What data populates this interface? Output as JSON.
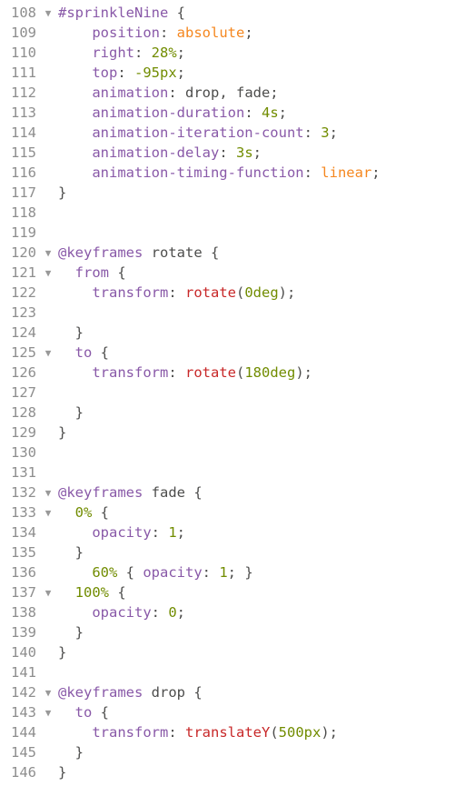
{
  "editor": {
    "lines": [
      {
        "n": "108",
        "fold": "▼",
        "tokens": [
          {
            "t": "#sprinkleNine",
            "c": "sel"
          },
          {
            "t": " {",
            "c": "txt"
          }
        ]
      },
      {
        "n": "109",
        "fold": "",
        "tokens": [
          {
            "t": "    ",
            "c": "txt"
          },
          {
            "t": "position",
            "c": "sel"
          },
          {
            "t": ": ",
            "c": "txt"
          },
          {
            "t": "absolute",
            "c": "val"
          },
          {
            "t": ";",
            "c": "txt"
          }
        ]
      },
      {
        "n": "110",
        "fold": "",
        "tokens": [
          {
            "t": "    ",
            "c": "txt"
          },
          {
            "t": "right",
            "c": "sel"
          },
          {
            "t": ": ",
            "c": "txt"
          },
          {
            "t": "28%",
            "c": "num"
          },
          {
            "t": ";",
            "c": "txt"
          }
        ]
      },
      {
        "n": "111",
        "fold": "",
        "tokens": [
          {
            "t": "    ",
            "c": "txt"
          },
          {
            "t": "top",
            "c": "sel"
          },
          {
            "t": ": ",
            "c": "txt"
          },
          {
            "t": "-95px",
            "c": "num"
          },
          {
            "t": ";",
            "c": "txt"
          }
        ]
      },
      {
        "n": "112",
        "fold": "",
        "tokens": [
          {
            "t": "    ",
            "c": "txt"
          },
          {
            "t": "animation",
            "c": "sel"
          },
          {
            "t": ": drop, fade;",
            "c": "txt"
          }
        ]
      },
      {
        "n": "113",
        "fold": "",
        "tokens": [
          {
            "t": "    ",
            "c": "txt"
          },
          {
            "t": "animation-duration",
            "c": "sel"
          },
          {
            "t": ": ",
            "c": "txt"
          },
          {
            "t": "4s",
            "c": "num"
          },
          {
            "t": ";",
            "c": "txt"
          }
        ]
      },
      {
        "n": "114",
        "fold": "",
        "tokens": [
          {
            "t": "    ",
            "c": "txt"
          },
          {
            "t": "animation-iteration-count",
            "c": "sel"
          },
          {
            "t": ": ",
            "c": "txt"
          },
          {
            "t": "3",
            "c": "num"
          },
          {
            "t": ";",
            "c": "txt"
          }
        ]
      },
      {
        "n": "115",
        "fold": "",
        "tokens": [
          {
            "t": "    ",
            "c": "txt"
          },
          {
            "t": "animation-delay",
            "c": "sel"
          },
          {
            "t": ": ",
            "c": "txt"
          },
          {
            "t": "3s",
            "c": "num"
          },
          {
            "t": ";",
            "c": "txt"
          }
        ]
      },
      {
        "n": "116",
        "fold": "",
        "tokens": [
          {
            "t": "    ",
            "c": "txt"
          },
          {
            "t": "animation-timing-function",
            "c": "sel"
          },
          {
            "t": ": ",
            "c": "txt"
          },
          {
            "t": "linear",
            "c": "val"
          },
          {
            "t": ";",
            "c": "txt"
          }
        ]
      },
      {
        "n": "117",
        "fold": "",
        "tokens": [
          {
            "t": "}",
            "c": "txt"
          }
        ]
      },
      {
        "n": "118",
        "fold": "",
        "tokens": []
      },
      {
        "n": "119",
        "fold": "",
        "tokens": []
      },
      {
        "n": "120",
        "fold": "▼",
        "tokens": [
          {
            "t": "@keyframes",
            "c": "sel"
          },
          {
            "t": " rotate {",
            "c": "txt"
          }
        ]
      },
      {
        "n": "121",
        "fold": "▼",
        "tokens": [
          {
            "t": "  ",
            "c": "txt"
          },
          {
            "t": "from",
            "c": "sel"
          },
          {
            "t": " {",
            "c": "txt"
          }
        ]
      },
      {
        "n": "122",
        "fold": "",
        "tokens": [
          {
            "t": "    ",
            "c": "txt"
          },
          {
            "t": "transform",
            "c": "sel"
          },
          {
            "t": ": ",
            "c": "txt"
          },
          {
            "t": "rotate",
            "c": "fn"
          },
          {
            "t": "(",
            "c": "txt"
          },
          {
            "t": "0deg",
            "c": "num"
          },
          {
            "t": ");",
            "c": "txt"
          }
        ]
      },
      {
        "n": "123",
        "fold": "",
        "tokens": []
      },
      {
        "n": "124",
        "fold": "",
        "tokens": [
          {
            "t": "  }",
            "c": "txt"
          }
        ]
      },
      {
        "n": "125",
        "fold": "▼",
        "tokens": [
          {
            "t": "  ",
            "c": "txt"
          },
          {
            "t": "to",
            "c": "sel"
          },
          {
            "t": " {",
            "c": "txt"
          }
        ]
      },
      {
        "n": "126",
        "fold": "",
        "tokens": [
          {
            "t": "    ",
            "c": "txt"
          },
          {
            "t": "transform",
            "c": "sel"
          },
          {
            "t": ": ",
            "c": "txt"
          },
          {
            "t": "rotate",
            "c": "fn"
          },
          {
            "t": "(",
            "c": "txt"
          },
          {
            "t": "180deg",
            "c": "num"
          },
          {
            "t": ");",
            "c": "txt"
          }
        ]
      },
      {
        "n": "127",
        "fold": "",
        "tokens": []
      },
      {
        "n": "128",
        "fold": "",
        "tokens": [
          {
            "t": "  }",
            "c": "txt"
          }
        ]
      },
      {
        "n": "129",
        "fold": "",
        "tokens": [
          {
            "t": "}",
            "c": "txt"
          }
        ]
      },
      {
        "n": "130",
        "fold": "",
        "tokens": []
      },
      {
        "n": "131",
        "fold": "",
        "tokens": []
      },
      {
        "n": "132",
        "fold": "▼",
        "tokens": [
          {
            "t": "@keyframes",
            "c": "sel"
          },
          {
            "t": " fade {",
            "c": "txt"
          }
        ]
      },
      {
        "n": "133",
        "fold": "▼",
        "tokens": [
          {
            "t": "  ",
            "c": "txt"
          },
          {
            "t": "0%",
            "c": "num"
          },
          {
            "t": " {",
            "c": "txt"
          }
        ]
      },
      {
        "n": "134",
        "fold": "",
        "tokens": [
          {
            "t": "    ",
            "c": "txt"
          },
          {
            "t": "opacity",
            "c": "sel"
          },
          {
            "t": ": ",
            "c": "txt"
          },
          {
            "t": "1",
            "c": "num"
          },
          {
            "t": ";",
            "c": "txt"
          }
        ]
      },
      {
        "n": "135",
        "fold": "",
        "tokens": [
          {
            "t": "  }",
            "c": "txt"
          }
        ]
      },
      {
        "n": "136",
        "fold": "",
        "tokens": [
          {
            "t": "    ",
            "c": "txt"
          },
          {
            "t": "60%",
            "c": "num"
          },
          {
            "t": " { ",
            "c": "txt"
          },
          {
            "t": "opacity",
            "c": "sel"
          },
          {
            "t": ": ",
            "c": "txt"
          },
          {
            "t": "1",
            "c": "num"
          },
          {
            "t": "; }",
            "c": "txt"
          }
        ]
      },
      {
        "n": "137",
        "fold": "▼",
        "tokens": [
          {
            "t": "  ",
            "c": "txt"
          },
          {
            "t": "100%",
            "c": "num"
          },
          {
            "t": " {",
            "c": "txt"
          }
        ]
      },
      {
        "n": "138",
        "fold": "",
        "tokens": [
          {
            "t": "    ",
            "c": "txt"
          },
          {
            "t": "opacity",
            "c": "sel"
          },
          {
            "t": ": ",
            "c": "txt"
          },
          {
            "t": "0",
            "c": "num"
          },
          {
            "t": ";",
            "c": "txt"
          }
        ]
      },
      {
        "n": "139",
        "fold": "",
        "tokens": [
          {
            "t": "  }",
            "c": "txt"
          }
        ]
      },
      {
        "n": "140",
        "fold": "",
        "tokens": [
          {
            "t": "}",
            "c": "txt"
          }
        ]
      },
      {
        "n": "141",
        "fold": "",
        "tokens": []
      },
      {
        "n": "142",
        "fold": "▼",
        "tokens": [
          {
            "t": "@keyframes",
            "c": "sel"
          },
          {
            "t": " drop {",
            "c": "txt"
          }
        ]
      },
      {
        "n": "143",
        "fold": "▼",
        "tokens": [
          {
            "t": "  ",
            "c": "txt"
          },
          {
            "t": "to",
            "c": "sel"
          },
          {
            "t": " {",
            "c": "txt"
          }
        ]
      },
      {
        "n": "144",
        "fold": "",
        "tokens": [
          {
            "t": "    ",
            "c": "txt"
          },
          {
            "t": "transform",
            "c": "sel"
          },
          {
            "t": ": ",
            "c": "txt"
          },
          {
            "t": "translateY",
            "c": "fn"
          },
          {
            "t": "(",
            "c": "txt"
          },
          {
            "t": "500px",
            "c": "num"
          },
          {
            "t": ");",
            "c": "txt"
          }
        ]
      },
      {
        "n": "145",
        "fold": "",
        "tokens": [
          {
            "t": "  }",
            "c": "txt"
          }
        ]
      },
      {
        "n": "146",
        "fold": "",
        "tokens": [
          {
            "t": "}",
            "c": "txt"
          }
        ]
      }
    ]
  }
}
